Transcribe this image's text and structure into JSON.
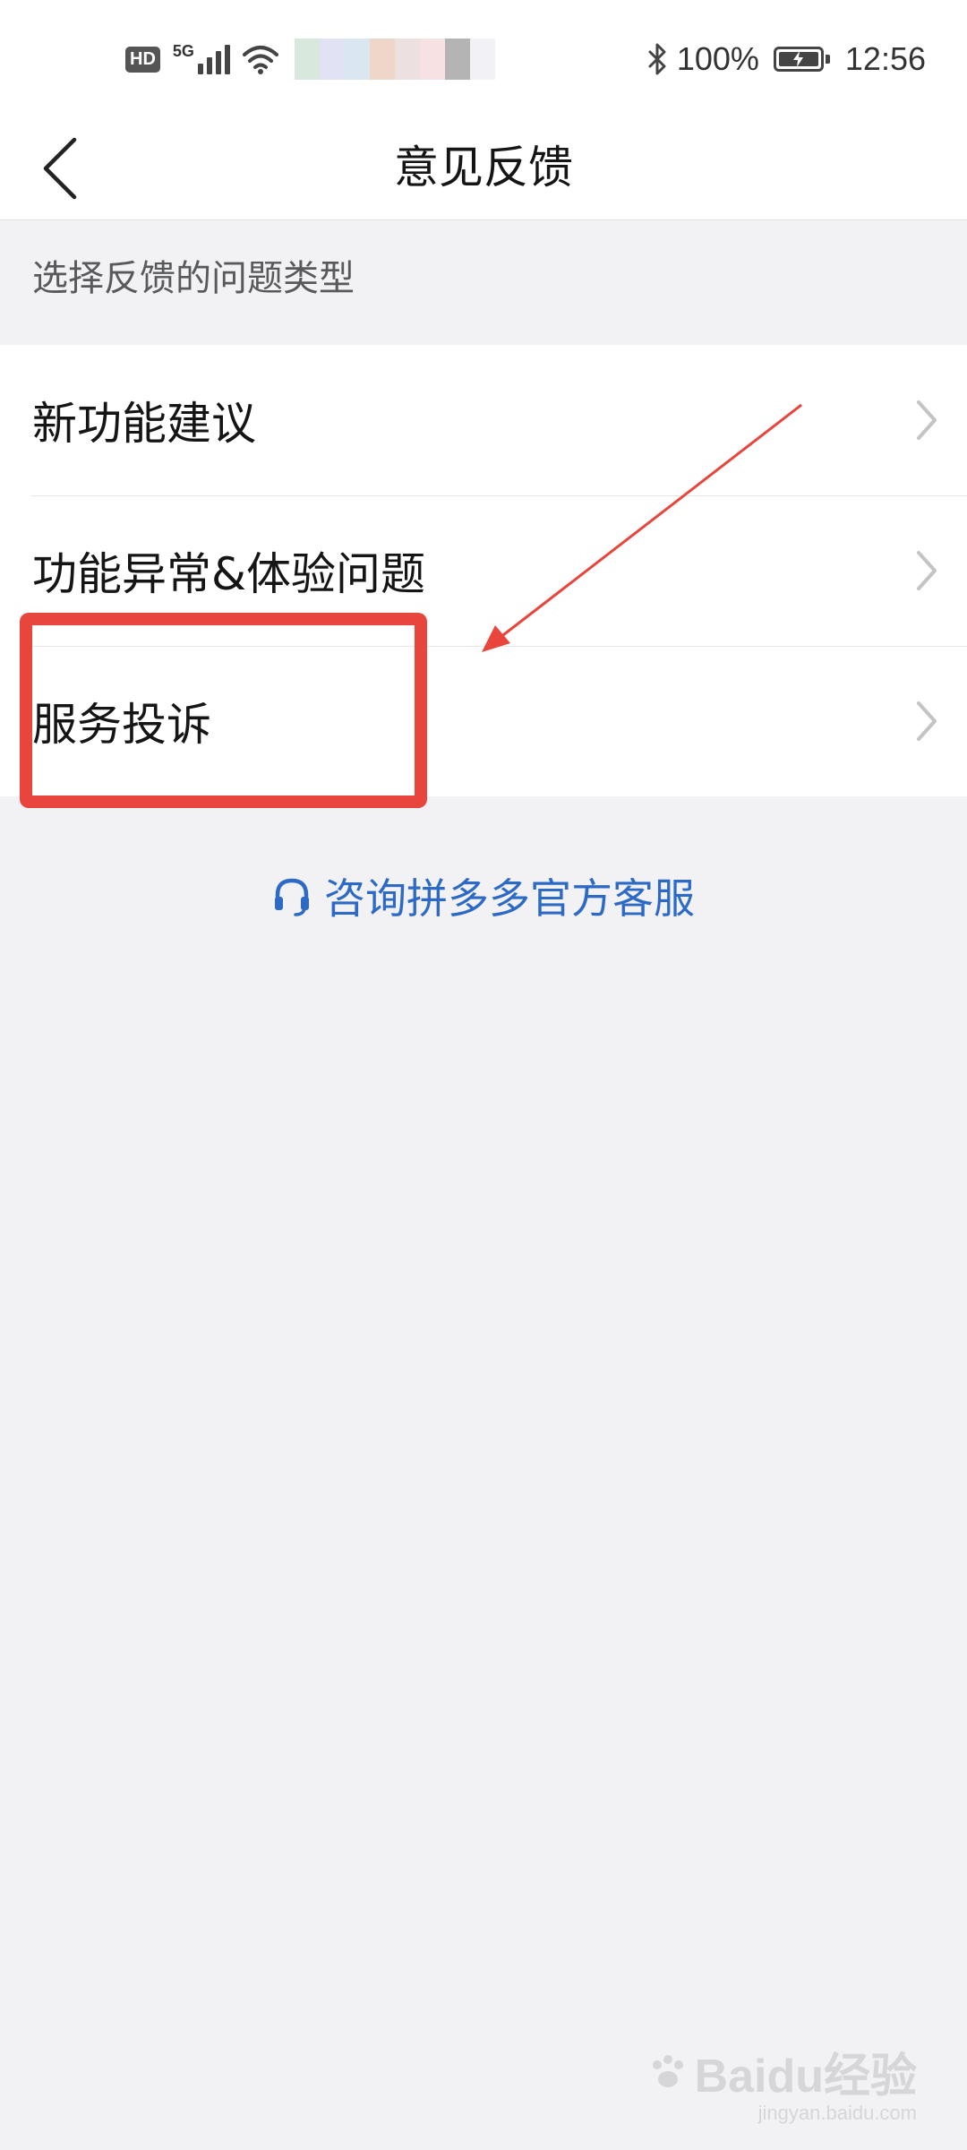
{
  "status_bar": {
    "hd_label": "HD",
    "network_label": "5G",
    "battery_percent": "100%",
    "time": "12:56",
    "icons": [
      "signal-icon",
      "wifi-icon",
      "bluetooth-icon",
      "battery-charging-icon"
    ]
  },
  "nav": {
    "title": "意见反馈",
    "back_icon": "chevron-left-icon"
  },
  "section": {
    "header": "选择反馈的问题类型"
  },
  "feedback_types": [
    {
      "label": "新功能建议",
      "icon": "chevron-right-icon"
    },
    {
      "label": "功能异常&体验问题",
      "icon": "chevron-right-icon"
    },
    {
      "label": "服务投诉",
      "icon": "chevron-right-icon"
    }
  ],
  "service": {
    "link_text": "咨询拼多多官方客服",
    "icon": "headset-icon",
    "color": "#2d6ac6"
  },
  "watermark": {
    "brand": "Baidu经验",
    "url": "jingyan.baidu.com"
  },
  "colors": {
    "background": "#f2f2f4",
    "surface": "#ffffff",
    "primary_text": "#151516",
    "secondary_text": "#58595b",
    "link": "#2d6ac6",
    "annotation": "#e8453c"
  }
}
